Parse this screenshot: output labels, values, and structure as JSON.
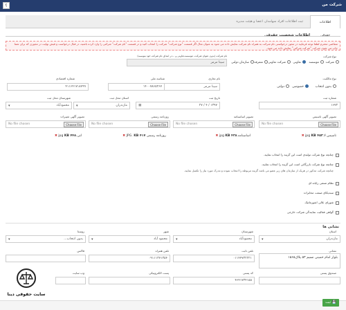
{
  "header": {
    "title": "شرکت من",
    "help_label": "؟"
  },
  "tabs": {
    "active": "اطلاعات حقوقی",
    "other": "ثبت اطلاعات افراد سهامدار، اعضا و هیئت مدیره"
  },
  "section_legal": "اطلاعات شخصیت حقوقی",
  "warning": "متقاضی محترم لطفا توجه فرمایید در مجوز درخواستی نام شرکت به همراه نام شرکت نمایش داده می شود به عنوان مثال اگر قسمت \"نوع شرکت\" شرکت را انتخاب کنید و در قسمت \"نام شرکت\" شرکتی را وارد کرده باشید، در قبال درخواست و فیش نهایت در مجوزی که برای شما چاپ می شود، شرکت \"شرکت شرکتی\" نمایش داده می شود.",
  "company_type": {
    "label": "نوع شرکت",
    "options": [
      "شرکت",
      "موسسه",
      "تعاونی",
      "شرکت تعاونی",
      "متفرقه",
      "سازمان دولتی"
    ],
    "selected": "تعاونی"
  },
  "company_name": {
    "label": "نام شرکت (بدون عنوان شرکت، موسسه،تعاونی و ...در ابتدای نام شرکت خود بنویسید)",
    "value": "سینا مرمر"
  },
  "ownership": {
    "label": "نوع مالکیت",
    "options": [
      "بدون انتخاب",
      "خصوصی",
      "دولتی"
    ],
    "selected": "خصوصی"
  },
  "brand": {
    "label": "نام تجاری",
    "value": "سینا مرمر"
  },
  "national_id": {
    "label": "شناسه ملی",
    "value": "۱۴۰۰۷۸۶۵۲۶۷"
  },
  "economic_code": {
    "label": "شماره اقتصادی",
    "value": "۴۱۱۶۴۱۷۱۸۷۹۹"
  },
  "reg_number": {
    "label": "شماره ثبت",
    "value": "۱۶۷۳"
  },
  "reg_date": {
    "label": "تاریخ ثبت",
    "value": "۱۳۹۷ / ۴ / ۲۷"
  },
  "reg_province": {
    "label": "استان محل ثبت",
    "value": "مازندران"
  },
  "reg_city": {
    "label": "شهرستان محل ثبت",
    "value": "محمودآباد"
  },
  "uploads": [
    {
      "label": "تصویر آگهی تاسیس",
      "btn": "Choose File",
      "nf": "No file chosen",
      "file": "تاسیس لا.jpg",
      "size": "KB ۴۵۳"
    },
    {
      "label": "تصویر اساسنامه",
      "btn": "Choose File",
      "nf": "No file chosen",
      "file": "اساسنامه.jpg",
      "size": "KB ۴۳۸"
    },
    {
      "label": "روزنامه رسمی",
      "btn": "Choose File",
      "nf": "No file chosen",
      "file": "روزنامه رسمی JPG.",
      "size": "KB ۴۱۷"
    },
    {
      "label": "تصویر آگهی تغییرات",
      "btn": "Choose File",
      "nf": "No file chosen",
      "file": "لتی.jpg",
      "size": "KB ۴۴۸"
    }
  ],
  "checks": [
    "چنانچه نوع شرکت تولیدی است این گزینه را انتخاب نمایید.",
    "چنانچه نوع شرکت بازرگانی است این گزینه را انتخاب نمایید."
  ],
  "note": "چنانچه شرکت مذکور در هریک از سازمان های زیر عضو می باشد گزینه مربوطه را انتخاب نموده و مدرک مورد نیاز را تکمیل نمایید.",
  "orgs": [
    "نظام صنفی رایانه ای",
    "سندیکای صنعت مخابرات",
    "شورای عالی انفورماتیک",
    "گواهی فعالیت نمایندگی شرکت خارجی"
  ],
  "section_address": "نشانی ها",
  "province": {
    "label": "استان",
    "value": "مازندران"
  },
  "county": {
    "label": "شهرستان",
    "value": "محمودآباد"
  },
  "city": {
    "label": "شهر",
    "value": "محمود آباد"
  },
  "village": {
    "label": "روستا",
    "value": "بدون انتخاب..."
  },
  "phone": {
    "label": "تلفن ثابت",
    "value": "۰۱۱۴۴۷۳۲۲۲۱"
  },
  "mobile": {
    "label": "تلفن همراه",
    "value": "۰۹۱۱۱۳۷۱۳۵۴"
  },
  "fax": {
    "label": "فاکس",
    "value": ""
  },
  "address": {
    "label": "نشانی",
    "value": "بلوار امام خمینی نسیم ۵۳ پلاک۱۵۶۵"
  },
  "postal_code": {
    "label": "کد پستی",
    "value": "۴۶۴۱۷۳۴۱۵۵"
  },
  "po_box": {
    "label": "صندوق پستی",
    "value": ""
  },
  "email": {
    "label": "پست الکترونیکی",
    "value": ""
  },
  "website": {
    "label": "وب سایت",
    "value": ""
  },
  "save_label": "ثبت",
  "logo_text": "سایت حقوقی دینا"
}
